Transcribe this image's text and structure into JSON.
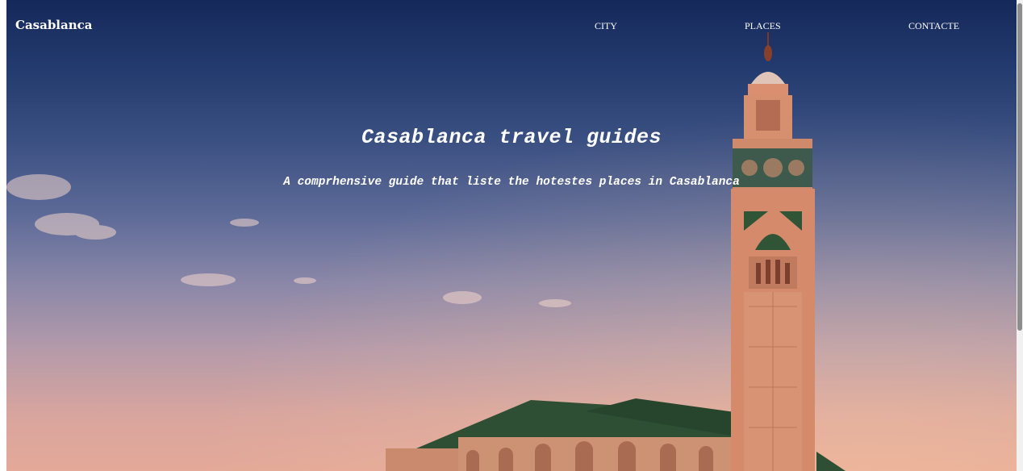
{
  "navbar": {
    "brand": "Casablanca",
    "links": [
      "CITY",
      "PLACES",
      "CONTACTE"
    ]
  },
  "hero": {
    "title": "Casablanca travel guides",
    "subtitle": "A comprhensive guide that liste the hotestes places in Casablanca"
  },
  "colors": {
    "sky_top": "#15285a",
    "sky_bottom": "#e4a998",
    "minaret": "#d98f70",
    "roof": "#2f5536",
    "text": "#ffffff"
  }
}
